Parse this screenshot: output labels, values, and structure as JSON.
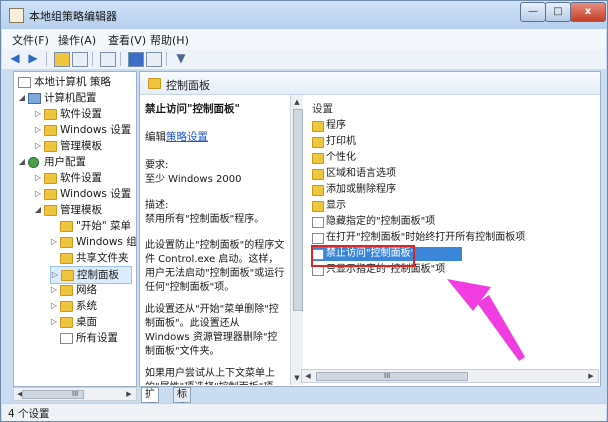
{
  "window": {
    "title": "本地组策略编辑器"
  },
  "title_buttons": {
    "minimize": "—",
    "maximize": "□",
    "close": "x"
  },
  "menubar": {
    "file": "文件(F)",
    "action": "操作(A)",
    "view": "查看(V)",
    "help": "帮助(H)"
  },
  "tree": {
    "root": "本地计算机 策略",
    "computer_config": "计算机配置",
    "software_settings_1": "软件设置",
    "windows_settings_1": "Windows 设置",
    "admin_templates_1": "管理模板",
    "user_config": "用户配置",
    "software_settings_2": "软件设置",
    "windows_settings_2": "Windows 设置",
    "admin_templates_2": "管理模板",
    "start_menu": "\"开始\" 菜单",
    "windows_components": "Windows 组",
    "shared_folders": "共享文件夹",
    "control_panel": "控制面板",
    "network": "网络",
    "system": "系统",
    "desktop": "桌面",
    "all_settings": "所有设置"
  },
  "pane": {
    "header": "控制面板"
  },
  "description": {
    "title": "禁止访问\"控制面板\"",
    "edit_prefix": "编辑",
    "edit_link": "策略设置",
    "requirements_label": "要求:",
    "requirements_value": "至少 Windows 2000",
    "desc_label": "描述:",
    "desc_value": "禁用所有\"控制面板\"程序。",
    "para1": "此设置防止\"控制面板\"的程序文件 Control.exe 启动。这样，用户无法启动\"控制面板\"或运行任何\"控制面板\"项。",
    "para2": "此设置还从\"开始\"菜单删除\"控制面板\"。此设置还从 Windows 资源管理器删除\"控制面板\"文件夹。",
    "para3": "如果用户尝试从上下文菜单上的\"属性\"项选择\"控制面板\"项"
  },
  "list": {
    "header": "设置",
    "items": [
      "程序",
      "打印机",
      "个性化",
      "区域和语言选项",
      "添加或删除程序",
      "显示",
      "隐藏指定的\"控制面板\"项",
      "在打开\"控制面板\"时始终打开所有控制面板项",
      "禁止访问\"控制面板\"",
      "只显示指定的\"控制面板\"项"
    ],
    "selected_index": 8
  },
  "tabs": {
    "extended": "扩展",
    "standard": "标准"
  },
  "scroll": {
    "left": "◀",
    "right": "▶",
    "up": "▲",
    "down": "▼",
    "mid": "III"
  },
  "status": {
    "text": "4 个设置"
  },
  "colors": {
    "selection": "#3b86d8",
    "highlight_box": "#e02424",
    "arrow": "#f03ce0"
  }
}
